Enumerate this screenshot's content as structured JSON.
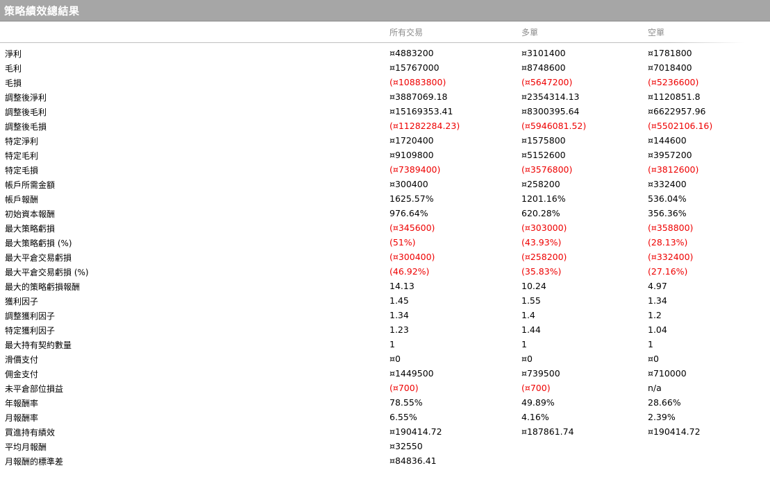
{
  "title": "策略績效總結果",
  "columns": {
    "all": "所有交易",
    "long": "多單",
    "short": "空單"
  },
  "rows": [
    {
      "label": "淨利",
      "all": "¤4883200",
      "long": "¤3101400",
      "short": "¤1781800",
      "neg": [
        false,
        false,
        false
      ]
    },
    {
      "label": "毛利",
      "all": "¤15767000",
      "long": "¤8748600",
      "short": "¤7018400",
      "neg": [
        false,
        false,
        false
      ]
    },
    {
      "label": "毛損",
      "all": "(¤10883800)",
      "long": "(¤5647200)",
      "short": "(¤5236600)",
      "neg": [
        true,
        true,
        true
      ]
    },
    {
      "label": "調整後淨利",
      "all": "¤3887069.18",
      "long": "¤2354314.13",
      "short": "¤1120851.8",
      "neg": [
        false,
        false,
        false
      ]
    },
    {
      "label": "調整後毛利",
      "all": "¤15169353.41",
      "long": "¤8300395.64",
      "short": "¤6622957.96",
      "neg": [
        false,
        false,
        false
      ]
    },
    {
      "label": "調整後毛損",
      "all": "(¤11282284.23)",
      "long": "(¤5946081.52)",
      "short": "(¤5502106.16)",
      "neg": [
        true,
        true,
        true
      ]
    },
    {
      "label": "特定淨利",
      "all": "¤1720400",
      "long": "¤1575800",
      "short": "¤144600",
      "neg": [
        false,
        false,
        false
      ]
    },
    {
      "label": "特定毛利",
      "all": "¤9109800",
      "long": "¤5152600",
      "short": "¤3957200",
      "neg": [
        false,
        false,
        false
      ]
    },
    {
      "label": "特定毛損",
      "all": "(¤7389400)",
      "long": "(¤3576800)",
      "short": "(¤3812600)",
      "neg": [
        true,
        true,
        true
      ]
    },
    {
      "label": "帳戶所需金額",
      "all": "¤300400",
      "long": "¤258200",
      "short": "¤332400",
      "neg": [
        false,
        false,
        false
      ]
    },
    {
      "label": "帳戶報酬",
      "all": "1625.57%",
      "long": "1201.16%",
      "short": "536.04%",
      "neg": [
        false,
        false,
        false
      ]
    },
    {
      "label": "初始資本報酬",
      "all": "976.64%",
      "long": "620.28%",
      "short": "356.36%",
      "neg": [
        false,
        false,
        false
      ]
    },
    {
      "label": "最大策略虧損",
      "all": "(¤345600)",
      "long": "(¤303000)",
      "short": "(¤358800)",
      "neg": [
        true,
        true,
        true
      ]
    },
    {
      "label": "最大策略虧損 (%)",
      "all": "(51%)",
      "long": "(43.93%)",
      "short": "(28.13%)",
      "neg": [
        true,
        true,
        true
      ]
    },
    {
      "label": "最大平倉交易虧損",
      "all": "(¤300400)",
      "long": "(¤258200)",
      "short": "(¤332400)",
      "neg": [
        true,
        true,
        true
      ]
    },
    {
      "label": "最大平倉交易虧損 (%)",
      "all": "(46.92%)",
      "long": "(35.83%)",
      "short": "(27.16%)",
      "neg": [
        true,
        true,
        true
      ]
    },
    {
      "label": "最大的策略虧損報酬",
      "all": "14.13",
      "long": "10.24",
      "short": "4.97",
      "neg": [
        false,
        false,
        false
      ]
    },
    {
      "label": "獲利因子",
      "all": "1.45",
      "long": "1.55",
      "short": "1.34",
      "neg": [
        false,
        false,
        false
      ]
    },
    {
      "label": "調整獲利因子",
      "all": "1.34",
      "long": "1.4",
      "short": "1.2",
      "neg": [
        false,
        false,
        false
      ]
    },
    {
      "label": "特定獲利因子",
      "all": "1.23",
      "long": "1.44",
      "short": "1.04",
      "neg": [
        false,
        false,
        false
      ]
    },
    {
      "label": "最大持有契約數量",
      "all": "1",
      "long": "1",
      "short": "1",
      "neg": [
        false,
        false,
        false
      ]
    },
    {
      "label": "滑價支付",
      "all": "¤0",
      "long": "¤0",
      "short": "¤0",
      "neg": [
        false,
        false,
        false
      ]
    },
    {
      "label": "佣金支付",
      "all": "¤1449500",
      "long": "¤739500",
      "short": "¤710000",
      "neg": [
        false,
        false,
        false
      ]
    },
    {
      "label": "未平倉部位損益",
      "all": "(¤700)",
      "long": "(¤700)",
      "short": "n/a",
      "neg": [
        true,
        true,
        false
      ]
    },
    {
      "label": "年報酬率",
      "all": "78.55%",
      "long": "49.89%",
      "short": "28.66%",
      "neg": [
        false,
        false,
        false
      ]
    },
    {
      "label": "月報酬率",
      "all": "6.55%",
      "long": "4.16%",
      "short": "2.39%",
      "neg": [
        false,
        false,
        false
      ]
    },
    {
      "label": "買進持有績效",
      "all": "¤190414.72",
      "long": "¤187861.74",
      "short": "¤190414.72",
      "neg": [
        false,
        false,
        false
      ]
    },
    {
      "label": "平均月報酬",
      "all": "¤32550",
      "long": "",
      "short": "",
      "neg": [
        false,
        false,
        false
      ]
    },
    {
      "label": "月報酬的標準差",
      "all": "¤84836.41",
      "long": "",
      "short": "",
      "neg": [
        false,
        false,
        false
      ]
    }
  ]
}
